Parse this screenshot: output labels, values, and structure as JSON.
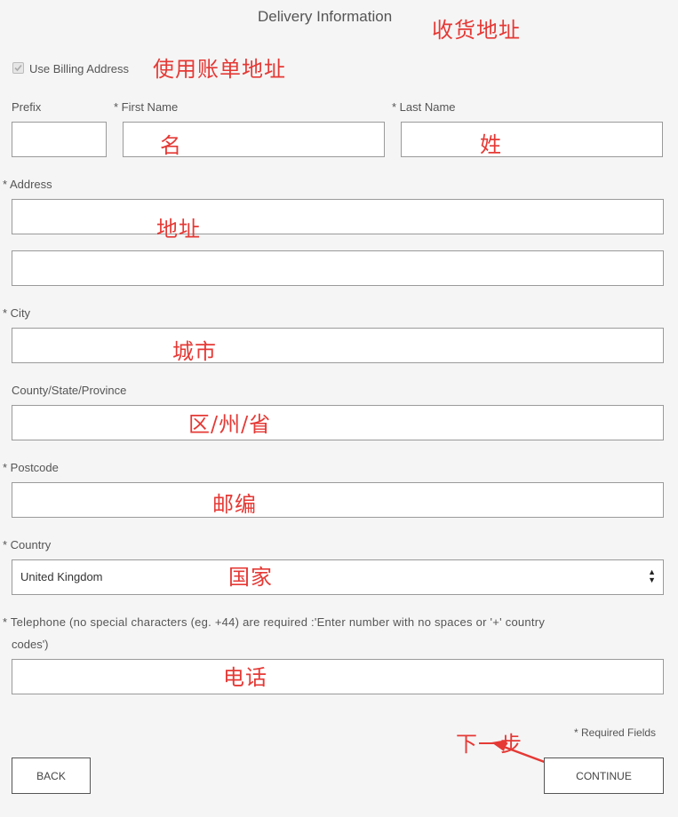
{
  "header": {
    "title": "Delivery Information",
    "annotation": "收货地址"
  },
  "billing": {
    "label": "Use Billing Address",
    "checked": true,
    "annotation": "使用账单地址"
  },
  "fields": {
    "prefix": {
      "label": "Prefix",
      "value": ""
    },
    "first_name": {
      "label": "* First Name",
      "value": "",
      "annotation": "名"
    },
    "last_name": {
      "label": "* Last Name",
      "value": "",
      "annotation": "姓"
    },
    "address": {
      "label": "* Address",
      "line1": "",
      "line2": "",
      "annotation": "地址"
    },
    "city": {
      "label": "* City",
      "value": "",
      "annotation": "城市"
    },
    "county": {
      "label": "County/State/Province",
      "value": "",
      "annotation": "区/州/省"
    },
    "postcode": {
      "label": "* Postcode",
      "value": "",
      "annotation": "邮编"
    },
    "country": {
      "label": "* Country",
      "selected": "United Kingdom",
      "annotation": "国家"
    },
    "telephone": {
      "label_line1": "* Telephone (no special characters (eg. +44) are required :'Enter number with no spaces or '+' country",
      "label_line2": "codes')",
      "value": "",
      "annotation": "电话"
    }
  },
  "footer": {
    "required_note": "* Required Fields",
    "back_label": "BACK",
    "continue_label": "CONTINUE",
    "continue_annotation": "下一步"
  },
  "colors": {
    "annotation": "#e53935",
    "background": "#f5f5f5",
    "border": "#9a9a9a"
  }
}
